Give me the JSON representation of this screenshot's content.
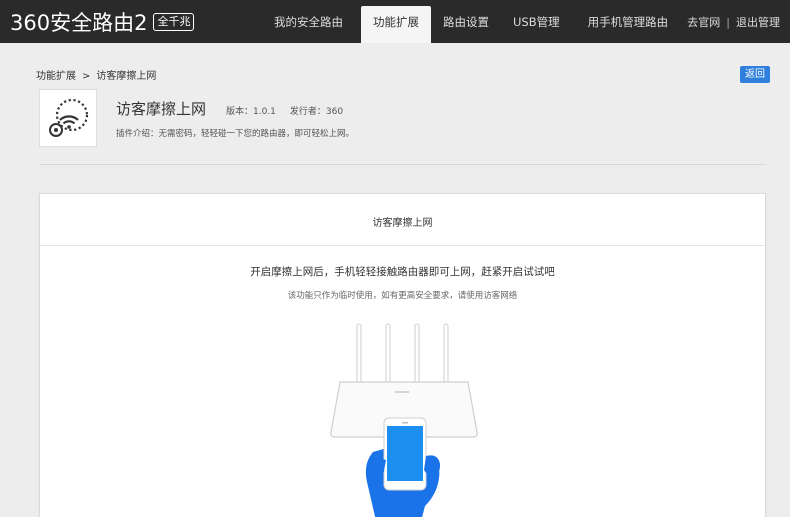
{
  "header": {
    "logo_text": "360安全路由2",
    "logo_badge": "全千兆",
    "nav": [
      {
        "label": "我的安全路由",
        "active": false
      },
      {
        "label": "功能扩展",
        "active": true
      },
      {
        "label": "路由设置",
        "active": false
      },
      {
        "label": "USB管理",
        "active": false
      },
      {
        "label": "用手机管理路由",
        "active": false
      }
    ],
    "links": {
      "official": "去官网",
      "logout": "退出管理"
    }
  },
  "breadcrumb": {
    "parent": "功能扩展",
    "separator": ">",
    "current": "访客摩擦上网"
  },
  "back_button": "返回",
  "plugin": {
    "icon": "wifi-touch-icon",
    "title": "访客摩擦上网",
    "version": "版本：1.0.1",
    "publisher": "发行者：360",
    "description": "插件介绍：无需密码，轻轻碰一下您的路由器，即可轻松上网。"
  },
  "card": {
    "title": "访客摩擦上网",
    "lead": "开启摩擦上网后，手机轻轻接触路由器即可上网，赶紧开启试试吧",
    "note": "该功能只作为临时使用，如有更高安全要求，请使用访客网络",
    "illustration": "router-phone-hand-illustration",
    "colors": {
      "phone_screen": "#1c8ff0",
      "hand": "#1a73e8"
    }
  }
}
